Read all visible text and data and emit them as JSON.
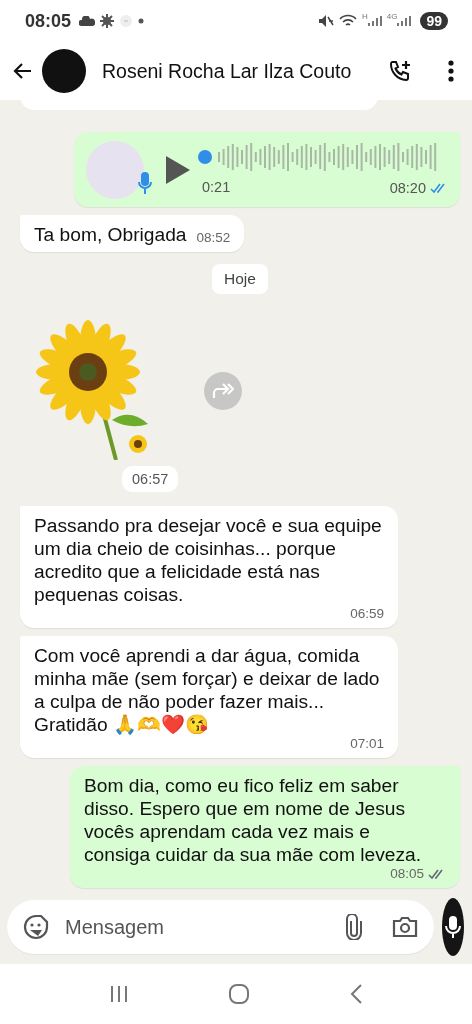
{
  "status_bar": {
    "time": "08:05",
    "network_labels": [
      "H",
      "4G"
    ],
    "battery": "99"
  },
  "header": {
    "contact_name": "Roseni Rocha Lar Ilza Couto"
  },
  "messages": [
    {
      "kind": "voice",
      "outgoing": true,
      "duration": "0:21",
      "time": "08:20",
      "level": 0,
      "read": true
    },
    {
      "kind": "text",
      "outgoing": false,
      "text": "Ta bom, Obrigada",
      "time": "08:52"
    },
    {
      "kind": "date",
      "text": "Hoje"
    },
    {
      "kind": "sticker",
      "time": "06:57"
    },
    {
      "kind": "text",
      "outgoing": false,
      "text": "Passando pra desejar você e sua equipe um dia cheio de coisinhas... porque acredito que a felicidade está nas pequenas coisas.",
      "time": "06:59"
    },
    {
      "kind": "text",
      "outgoing": false,
      "text": "Com você aprendi a dar água, comida minha mãe (sem forçar) e deixar de lado a culpa de não poder fazer mais... Gratidão 🙏🫶❤️😘",
      "time": "07:01"
    },
    {
      "kind": "text",
      "outgoing": true,
      "text": "Bom dia, como eu fico feliz em saber disso. Espero que em nome de Jesus vocês aprendam cada vez mais e consiga cuidar da sua mãe com leveza.",
      "time": "08:05",
      "read": false
    }
  ],
  "composer": {
    "placeholder": "Mensagem"
  }
}
